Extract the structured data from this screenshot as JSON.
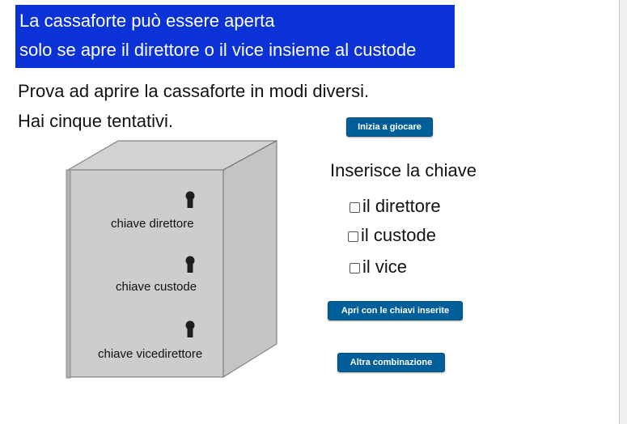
{
  "banner": {
    "line1": "La cassaforte può essere aperta",
    "line2": "solo se apre il direttore o il vice insieme al custode",
    "color": "#0a32d6"
  },
  "instructions": {
    "line1": "Prova ad aprire la cassaforte in modi diversi.",
    "line2": "Hai cinque tentativi."
  },
  "buttons": {
    "start": "Inizia a giocare",
    "open": "Apri con le chiavi inserite",
    "other": "Altra combinazione",
    "color": "#005f99"
  },
  "safe": {
    "keyholes": [
      {
        "label": "chiave direttore",
        "icon": "keyhole-icon"
      },
      {
        "label": "chiave custode",
        "icon": "keyhole-icon"
      },
      {
        "label": "chiave vicedirettore",
        "icon": "keyhole-icon"
      }
    ]
  },
  "panel": {
    "title": "Inserisce la chiave",
    "options": [
      {
        "label": "il direttore",
        "checked": false
      },
      {
        "label": "il custode",
        "checked": false
      },
      {
        "label": "il vice",
        "checked": false
      }
    ]
  }
}
